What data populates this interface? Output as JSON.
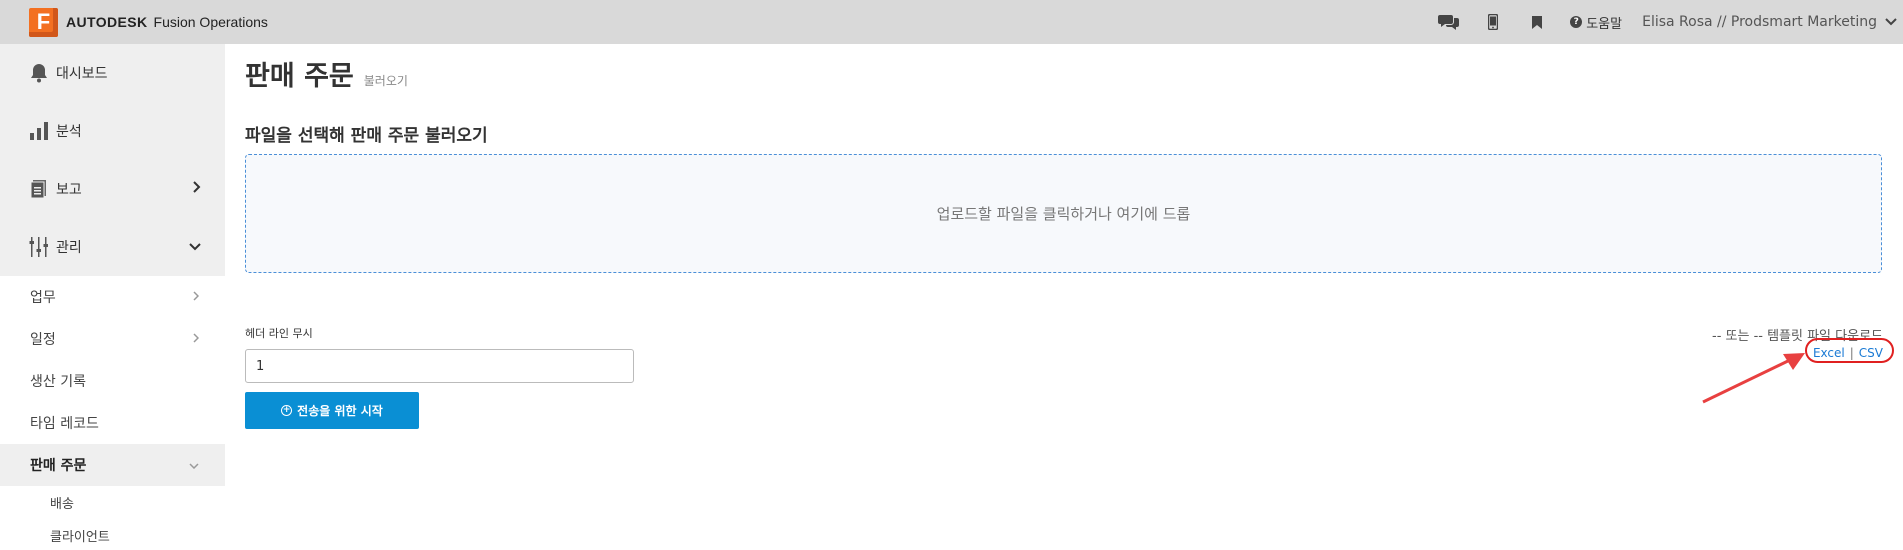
{
  "topbar": {
    "brand": "AUTODESK",
    "product": "Fusion Operations",
    "help_label": "도움말",
    "user_label": "Elisa Rosa // Prodsmart Marketing",
    "icons": [
      "chat-icon",
      "mobile-icon",
      "bookmark-icon",
      "help-icon",
      "chevron-down-icon"
    ]
  },
  "sidebar": {
    "dashboard": "대시보드",
    "analysis": "분석",
    "reports": "보고",
    "management": "관리",
    "tasks": "업무",
    "schedule": "일정",
    "production_log": "생산 기록",
    "time_record": "타임 레코드",
    "sales_order": "판매 주문",
    "shipping": "배송",
    "client": "클라이언트"
  },
  "main": {
    "title": "판매 주문",
    "subtitle": "불러오기",
    "section_title": "파일을 선택해 판매 주문 불러오기",
    "dropzone_text": "업로드할 파일을 클릭하거나 여기에 드롭",
    "header_lines_label": "헤더 라인 무시",
    "header_lines_value": "1",
    "start_button": "전송을 위한 시작",
    "template_text": "-- 또는 -- 템플릿 파일 다운로드",
    "excel_link": "Excel",
    "separator": "|",
    "csv_link": "CSV"
  },
  "colors": {
    "accent": "#0a8fd4",
    "logo": "#f37021",
    "annotation": "#e02020",
    "topbar_bg": "#d9d9d9",
    "sidebar_bg": "#efefef"
  }
}
